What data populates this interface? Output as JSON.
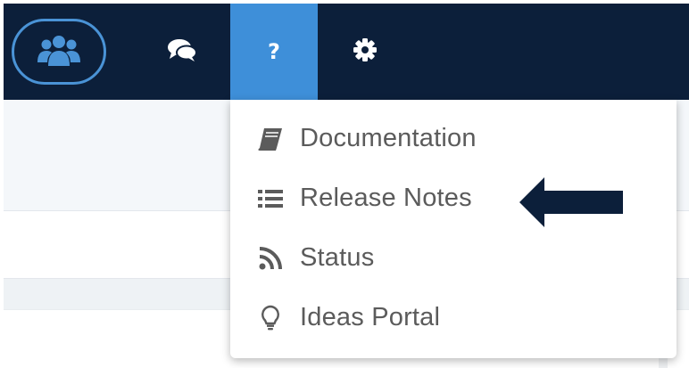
{
  "colors": {
    "topbar": "#0c1f3a",
    "active_tab": "#3e8fd9",
    "team_ring": "#4a93d6",
    "menu_text": "#5b5b5b",
    "arrow": "#0c1f3a"
  },
  "navbar": {
    "items": [
      {
        "icon": "team-icon"
      },
      {
        "icon": "chat-icon"
      },
      {
        "icon": "help-icon",
        "glyph": "?",
        "active": true
      },
      {
        "icon": "gear-icon"
      }
    ]
  },
  "help_menu": {
    "items": [
      {
        "label": "Documentation",
        "icon": "book-icon"
      },
      {
        "label": "Release Notes",
        "icon": "list-icon"
      },
      {
        "label": "Status",
        "icon": "rss-icon"
      },
      {
        "label": "Ideas Portal",
        "icon": "lightbulb-icon"
      }
    ]
  },
  "annotation": {
    "icon": "arrow-left-icon",
    "points_to": "Release Notes"
  }
}
